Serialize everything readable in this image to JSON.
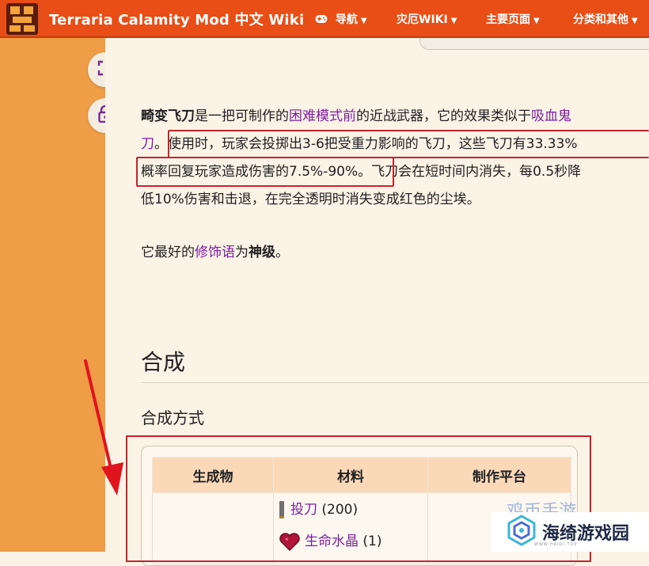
{
  "header": {
    "site_title": "Terraria Calamity Mod 中文 Wiki",
    "nav": [
      {
        "label": "导航",
        "icon": "gamepad-icon"
      },
      {
        "label": "灾厄WIKI"
      },
      {
        "label": "主要页面"
      },
      {
        "label": "分类和其他"
      }
    ]
  },
  "rail": {
    "buttons": [
      {
        "icon": "fullscreen-icon"
      },
      {
        "icon": "lock-icon"
      }
    ]
  },
  "article": {
    "lead": {
      "l1_name": "畸变飞刀",
      "l1_a": "是一把可制作的",
      "l1_link1": "困难模式前",
      "l1_b": "的近战武器，它的效果类似于",
      "l1_link2": "吸血鬼",
      "l2_link2_tail": "刀",
      "l2_a": "。",
      "l2_b": "使用时，玩家会投掷出3-6把受重力影响的飞刀，这些飞刀有33.33%",
      "l3_a": "概率回复玩家造成伤害的7.5%-90%。",
      "l3_b": "飞刀会在短时间内消失，每0.5秒降",
      "l4": "低10%伤害和击退，在完全透明时消失变成红色的尘埃。"
    },
    "modifier": {
      "a": "它最好的",
      "link": "修饰语",
      "b": "为",
      "value": "神级",
      "c": "。"
    },
    "section_title": "合成",
    "subsection_title": "合成方式",
    "recipe": {
      "headers": [
        "生成物",
        "材料",
        "制作平台"
      ],
      "materials": [
        {
          "name": "投刀",
          "qty": "(200)",
          "icon": "throwing-knife-icon"
        },
        {
          "name": "生命水晶",
          "qty": "(1)",
          "icon": "life-crystal-icon"
        }
      ]
    }
  },
  "watermark": {
    "ghost": "鸡币手游",
    "name": "海绮游戏园",
    "sub": "WWW.HAIQI.TOP"
  },
  "colors": {
    "topbar": "#e84e15",
    "rail": "#ef9d47",
    "link": "#7b1fa2",
    "annotation": "#c8232c"
  }
}
